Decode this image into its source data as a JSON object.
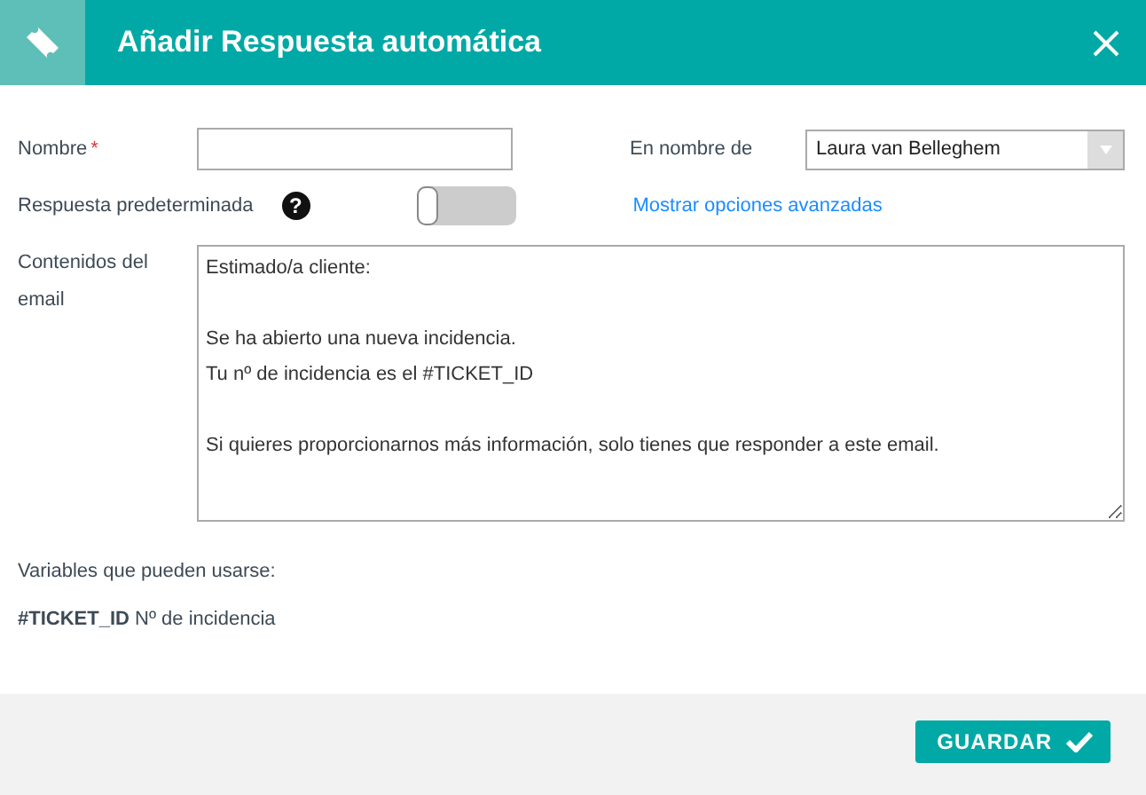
{
  "window": {
    "title": "Añadir Respuesta automática"
  },
  "form": {
    "name_label": "Nombre",
    "required_mark": "*",
    "sender_label": "En nombre de",
    "sender_value": "Laura van Belleghem",
    "default_label": "Respuesta predeterminada",
    "help_icon": "?",
    "default_toggle": {
      "on": false
    },
    "advanced_link": "Mostrar opciones avanzadas",
    "content_label": "Contenidos del email",
    "content_value": "Estimado/a cliente:\n\nSe ha abierto una nueva incidencia.\nTu nº de incidencia es el #TICKET_ID\n\nSi quieres proporcionarnos más información, solo tienes que responder a este email.",
    "variables_label": "Variables que pueden usarse:",
    "variables": [
      "**#TICKET_ID** Nº de incidencia"
    ]
  },
  "buttons": [
    {
      "label": "GUARDAR"
    }
  ]
}
